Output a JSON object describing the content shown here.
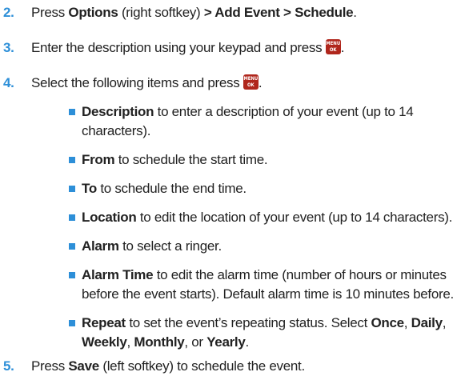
{
  "steps": [
    {
      "number": "2.",
      "press": "Press ",
      "options": "Options",
      "paren": " (right softkey) ",
      "path": "> Add Event > Schedule",
      "end": "."
    },
    {
      "number": "3.",
      "text": "Enter the description using your keypad and press ",
      "end": "."
    },
    {
      "number": "4.",
      "text": "Select the following items and press ",
      "end": "."
    },
    {
      "number": "5.",
      "press": "Press ",
      "save": "Save",
      "rest": " (left softkey) to schedule the event."
    }
  ],
  "key_icon": {
    "line1": "MENU",
    "line2": "OK",
    "color": "#b0261c"
  },
  "items": [
    {
      "term": "Description",
      "line1": " to enter a description of your event (up to 14",
      "line2": "characters)."
    },
    {
      "term": "From",
      "text": " to schedule the start time."
    },
    {
      "term": "To",
      "text": " to schedule the end time."
    },
    {
      "term": "Location",
      "text": " to edit the location of your event (up to 14 characters)."
    },
    {
      "term": "Alarm",
      "text": " to select a ringer."
    },
    {
      "term": "Alarm Time",
      "line1": " to edit the alarm time (number of hours or minutes",
      "line2": "before the event starts). Default alarm time is 10 minutes before."
    },
    {
      "term": "Repeat",
      "line1": " to set the event’s repeating status. Select ",
      "once": "Once",
      "sep1": ", ",
      "daily": "Daily",
      "sep2": ",",
      "weekly": "Weekly",
      "sep3": ", ",
      "monthly": "Monthly",
      "sep4": ", or ",
      "yearly": "Yearly",
      "end": "."
    }
  ],
  "colors": {
    "accent": "#2d8fd8",
    "text": "#222222"
  }
}
